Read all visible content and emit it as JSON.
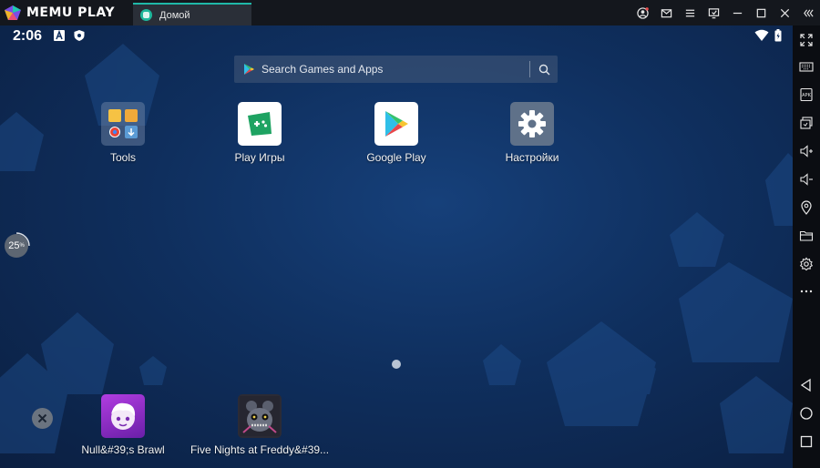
{
  "titlebar": {
    "brand": "MEMU PLAY",
    "tab_label": "Домой"
  },
  "statusbar": {
    "time": "2:06"
  },
  "search": {
    "placeholder": "Search Games and Apps"
  },
  "apps": [
    {
      "label": "Tools",
      "icon": "tools-folder-icon"
    },
    {
      "label": "Play Игры",
      "icon": "play-games-icon"
    },
    {
      "label": "Google Play",
      "icon": "google-play-icon"
    },
    {
      "label": "Настройки",
      "icon": "settings-gear-icon"
    }
  ],
  "dock_apps": [
    {
      "label": "Null&#39;s Brawl",
      "icon": "nulls-brawl-icon"
    },
    {
      "label": "Five Nights at Freddy&#39...",
      "icon": "fnaf-icon"
    }
  ],
  "fps": {
    "value": "25"
  },
  "colors": {
    "accent": "#1fb8a8",
    "titlebar_bg": "#14171d",
    "sidebar_bg": "#0b0d12",
    "wallpaper": "#0f2f5e"
  }
}
